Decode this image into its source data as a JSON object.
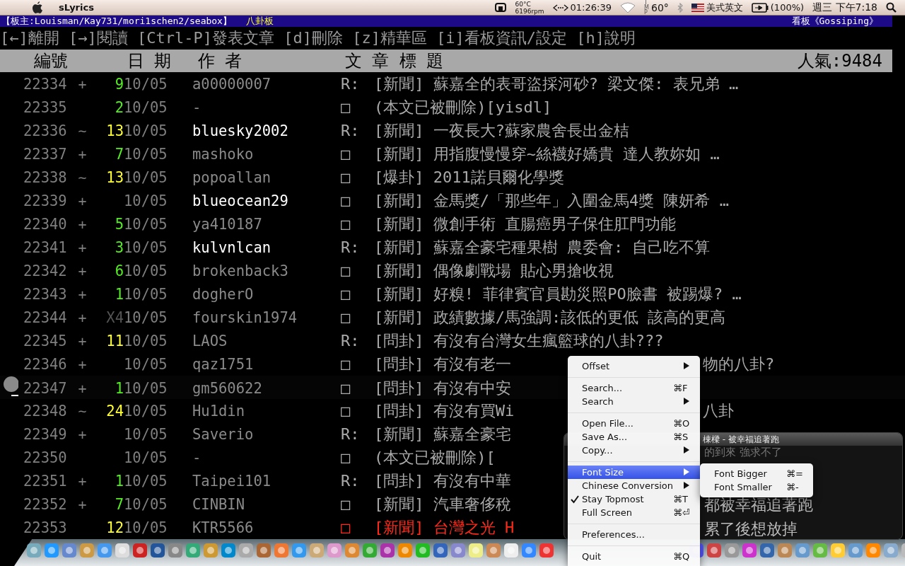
{
  "menubar": {
    "app": "sLyrics",
    "cpu_temp": "60°C",
    "fan_speed": "6196rpm",
    "timer": "01:26:39",
    "tmp_label": "TMP",
    "temperature": "60°",
    "input_source": "美式英文",
    "battery": "(100%)",
    "clock": "週三 下午7:18"
  },
  "board_header": {
    "moderators": "【板主:Louisman/Kay731/mori1schen2/seabox】",
    "board_name": "八卦板",
    "board_title": "看板《Gossiping》"
  },
  "help_line": "[←]離開 [→]閱讀 [Ctrl-P]發表文章 [d]刪除 [z]精華區 [i]看板資訊/設定 [h]說明",
  "columns": [
    "編號",
    "日 期",
    "作 者",
    "文 章 標 題"
  ],
  "popularity": "人氣:9484",
  "rows": [
    {
      "number": "22334",
      "mark": "+",
      "push": {
        "text": "9",
        "color": "#55ee22"
      },
      "date": "10/05",
      "author": "a00000007",
      "highlighted": false,
      "type": "R:",
      "title": "[新聞] 蘇嘉全的表哥盜採河砂? 梁文傑: 表兄弟 …",
      "color": "#aaaaaa",
      "selected": false
    },
    {
      "number": "22335",
      "push": {
        "text": "2",
        "color": "#55ee22"
      },
      "date": "10/05",
      "author": "-",
      "highlighted": false,
      "type": "□",
      "title": "(本文已被刪除)[yisdl]",
      "color": "#aaaaaa",
      "selected": false
    },
    {
      "number": "22336",
      "mark": "~",
      "push": {
        "text": "13",
        "color": "#ffff33"
      },
      "date": "10/05",
      "author": "bluesky2002",
      "highlighted": true,
      "type": "R:",
      "title": "[新聞] 一夜長大?蘇家農舍長出金桔",
      "color": "#aaaaaa",
      "selected": false
    },
    {
      "number": "22337",
      "mark": "+",
      "push": {
        "text": "7",
        "color": "#55ee22"
      },
      "date": "10/05",
      "author": "mashoko",
      "highlighted": false,
      "type": "□",
      "title": "[新聞] 用指腹慢慢穿~絲襪好嬌貴  達人教妳如 …",
      "color": "#aaaaaa",
      "selected": false
    },
    {
      "number": "22338",
      "mark": "~",
      "push": {
        "text": "13",
        "color": "#ffff33"
      },
      "date": "10/05",
      "author": "popoallan",
      "highlighted": false,
      "type": "□",
      "title": "[爆卦] 2011諾貝爾化學獎",
      "color": "#aaaaaa",
      "selected": false
    },
    {
      "number": "22339",
      "mark": "+",
      "date": "10/05",
      "author": "blueocean29",
      "highlighted": true,
      "type": "□",
      "title": "[新聞] 金馬獎/「那些年」入圍金馬4獎  陳妍希 …",
      "color": "#aaaaaa",
      "selected": false
    },
    {
      "number": "22340",
      "mark": "+",
      "push": {
        "text": "5",
        "color": "#55ee22"
      },
      "date": "10/05",
      "author": "ya410187",
      "highlighted": false,
      "type": "□",
      "title": "[新聞] 微創手術 直腸癌男子保住肛門功能",
      "color": "#aaaaaa",
      "selected": false
    },
    {
      "number": "22341",
      "mark": "+",
      "push": {
        "text": "3",
        "color": "#55ee22"
      },
      "date": "10/05",
      "author": "kulvnlcan",
      "highlighted": true,
      "type": "R:",
      "title": "[新聞] 蘇嘉全豪宅種果樹 農委會: 自己吃不算",
      "color": "#aaaaaa",
      "selected": false
    },
    {
      "number": "22342",
      "mark": "+",
      "push": {
        "text": "6",
        "color": "#55ee22"
      },
      "date": "10/05",
      "author": "brokenback3",
      "highlighted": false,
      "type": "□",
      "title": "[新聞] 偶像劇戰場 貼心男搶收視",
      "color": "#aaaaaa",
      "selected": false
    },
    {
      "number": "22343",
      "mark": "+",
      "push": {
        "text": "1",
        "color": "#55ee22"
      },
      "date": "10/05",
      "author": "dogherO",
      "highlighted": false,
      "type": "□",
      "title": "[新聞] 好糗! 菲律賓官員勘災照PO臉書 被踢爆? …",
      "color": "#aaaaaa",
      "selected": false
    },
    {
      "number": "22344",
      "mark": "+",
      "push": {
        "text": "X4",
        "color": "#555555"
      },
      "date": "10/05",
      "author": "fourskin1974",
      "highlighted": false,
      "type": "□",
      "title": "[新聞] 政績數據/馬強調:該低的更低  該高的更高",
      "color": "#aaaaaa",
      "selected": false
    },
    {
      "number": "22345",
      "mark": "+",
      "push": {
        "text": "11",
        "color": "#ffff33"
      },
      "date": "10/05",
      "author": "LAOS",
      "highlighted": false,
      "type": "R:",
      "title": "[問卦] 有沒有台灣女生瘋籃球的八卦???",
      "color": "#aaaaaa",
      "selected": false
    },
    {
      "number": "22346",
      "mark": "+",
      "date": "10/05",
      "author": "qaz1751",
      "highlighted": false,
      "type": "□",
      "title": "[問卦] 有沒有老一",
      "tail": "物的八卦?",
      "color": "#aaaaaa",
      "selected": false
    },
    {
      "number": "22347",
      "mark": "+",
      "push": {
        "text": "1",
        "color": "#55ee22"
      },
      "date": "10/05",
      "author": "gm560622",
      "highlighted": false,
      "type": "□",
      "title": "[問卦] 有沒有中安",
      "color": "#aaaaaa",
      "selected": true
    },
    {
      "number": "22348",
      "mark": "~",
      "push": {
        "text": "24",
        "color": "#ffff33"
      },
      "date": "10/05",
      "author": "Hu1din",
      "highlighted": false,
      "type": "□",
      "title": "[問卦] 有沒有買Wi",
      "tail": "八卦",
      "color": "#aaaaaa",
      "selected": false
    },
    {
      "number": "22349",
      "mark": "+",
      "date": "10/05",
      "author": "Saverio",
      "highlighted": false,
      "type": "R:",
      "title": "[新聞] 蘇嘉全豪宅",
      "color": "#aaaaaa",
      "selected": false
    },
    {
      "number": "22350",
      "date": "10/05",
      "author": "-",
      "highlighted": false,
      "type": "□",
      "title": "(本文已被刪除)[",
      "color": "#aaaaaa",
      "selected": false
    },
    {
      "number": "22351",
      "mark": "+",
      "push": {
        "text": "1",
        "color": "#55ee22"
      },
      "date": "10/05",
      "author": "Taipei101",
      "highlighted": false,
      "type": "R:",
      "title": "[問卦] 有沒有中華",
      "color": "#aaaaaa",
      "selected": false
    },
    {
      "number": "22352",
      "mark": "+",
      "push": {
        "text": "7",
        "color": "#55ee22"
      },
      "date": "10/05",
      "author": "CINBIN",
      "highlighted": false,
      "type": "□",
      "title": "[新聞] 汽車奢侈稅",
      "color": "#aaaaaa",
      "selected": false
    },
    {
      "number": "22353",
      "push": {
        "text": "12",
        "color": "#ffff33"
      },
      "date": "10/05",
      "author": "KTR5566",
      "highlighted": false,
      "type": "□",
      "title": "[新聞] 台灣之光 H",
      "color": "#ff2a1a",
      "selected": false
    }
  ],
  "context_menu": {
    "items": [
      {
        "kind": "item",
        "label": "Offset",
        "submenu": true,
        "checked": false,
        "selected": false
      },
      {
        "kind": "separator"
      },
      {
        "kind": "item",
        "label": "Search...",
        "shortcut": "⌘F",
        "submenu": false,
        "checked": false,
        "selected": false
      },
      {
        "kind": "item",
        "label": "Search",
        "submenu": true,
        "checked": false,
        "selected": false
      },
      {
        "kind": "separator"
      },
      {
        "kind": "item",
        "label": "Open File...",
        "shortcut": "⌘O",
        "submenu": false,
        "checked": false,
        "selected": false
      },
      {
        "kind": "item",
        "label": "Save As...",
        "shortcut": "⌘S",
        "submenu": false,
        "checked": false,
        "selected": false
      },
      {
        "kind": "item",
        "label": "Copy...",
        "submenu": true,
        "checked": false,
        "selected": false
      },
      {
        "kind": "separator"
      },
      {
        "kind": "item",
        "label": "Font Size",
        "submenu": true,
        "checked": false,
        "selected": true
      },
      {
        "kind": "item",
        "label": "Chinese Conversion",
        "submenu": true,
        "checked": false,
        "selected": false
      },
      {
        "kind": "item",
        "label": "Stay Topmost",
        "shortcut": "⌘T",
        "submenu": false,
        "checked": true,
        "selected": false
      },
      {
        "kind": "item",
        "label": "Full Screen",
        "shortcut": "⌘⏎",
        "submenu": false,
        "checked": false,
        "selected": false
      },
      {
        "kind": "separator"
      },
      {
        "kind": "item",
        "label": "Preferences...",
        "submenu": false,
        "checked": false,
        "selected": false
      },
      {
        "kind": "separator"
      },
      {
        "kind": "item",
        "label": "Quit",
        "shortcut": "⌘Q",
        "submenu": false,
        "checked": false,
        "selected": false
      }
    ],
    "submenu": [
      {
        "label": "Font Bigger",
        "shortcut": "⌘="
      },
      {
        "label": "Font Smaller",
        "shortcut": "⌘-"
      }
    ]
  },
  "lyrics_window": {
    "title": "棟樑 - 被幸福追著跑",
    "lines": [
      "的到來 強求不了",
      "都被幸福追著跑",
      "累了後想放掉"
    ]
  }
}
